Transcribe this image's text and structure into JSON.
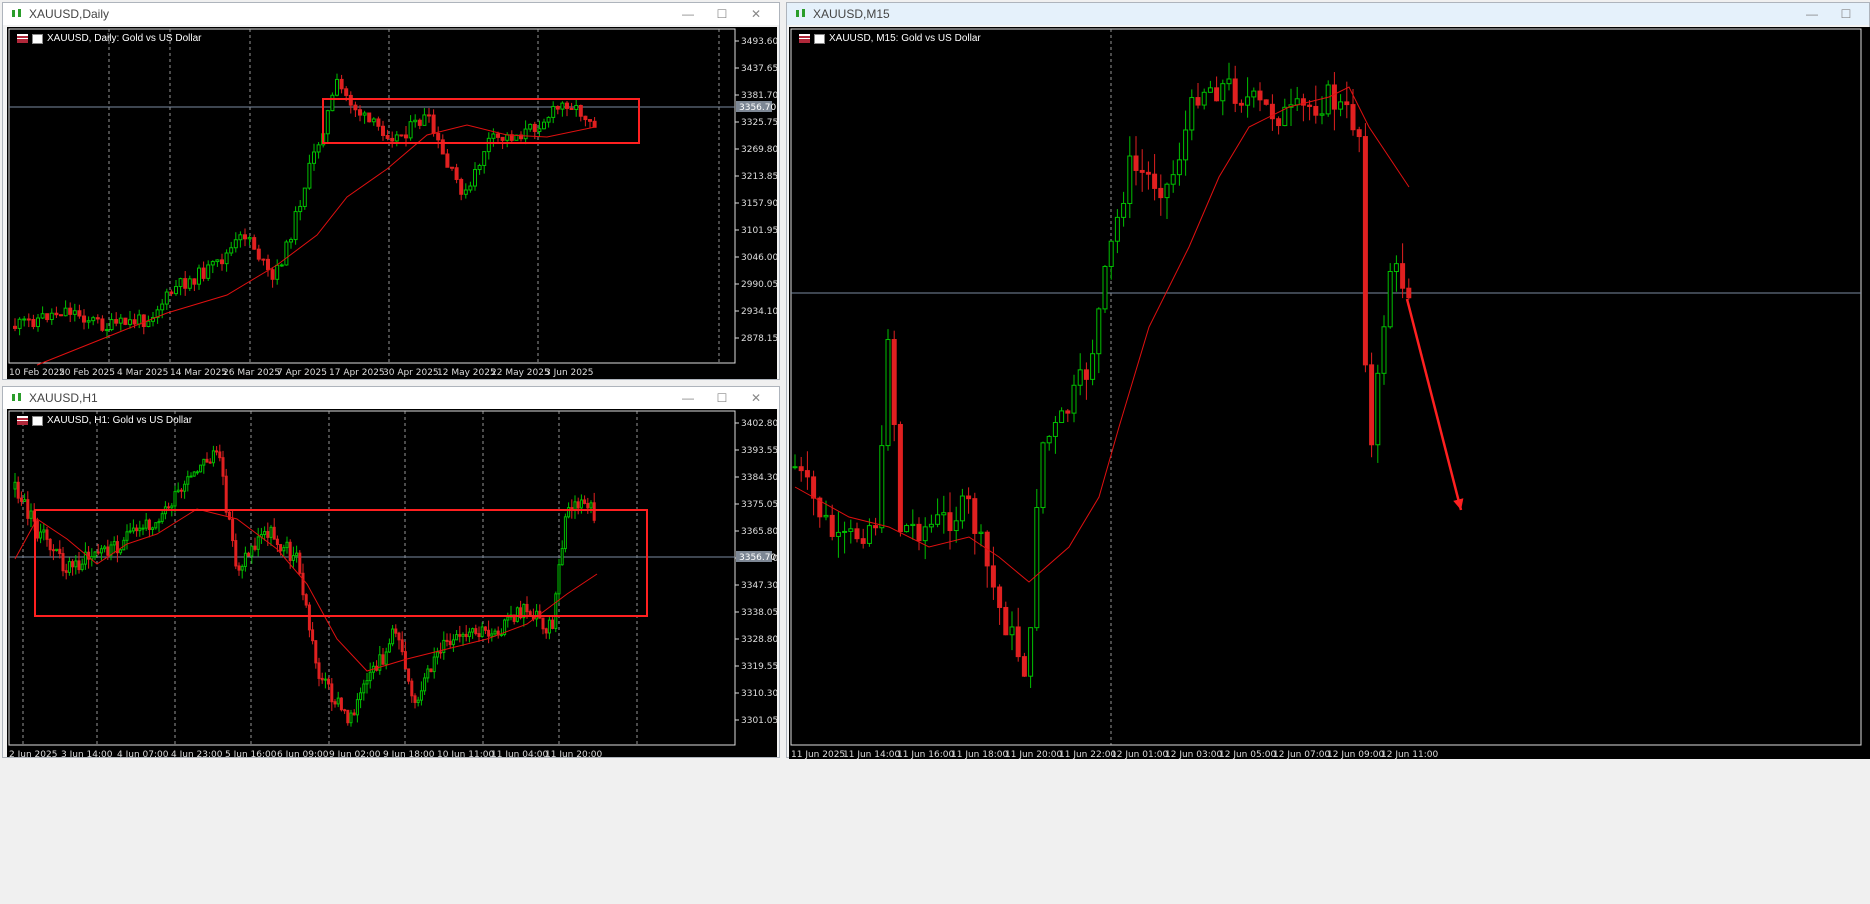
{
  "windows": {
    "daily": {
      "title": "XAUUSD,Daily",
      "label": "XAUUSD, Daily:  Gold vs US Dollar",
      "price_ticks": [
        "3493.60",
        "3437.65",
        "3381.70",
        "3325.75",
        "3269.80",
        "3213.85",
        "3157.90",
        "3101.95",
        "3046.00",
        "2990.05",
        "2934.10",
        "2878.15"
      ],
      "current_price": "3356.70",
      "time_ticks": [
        "10 Feb 2025",
        "20 Feb 2025",
        "4 Mar 2025",
        "14 Mar 2025",
        "26 Mar 2025",
        "7 Apr 2025",
        "17 Apr 2025",
        "30 Apr 2025",
        "12 May 2025",
        "22 May 2025",
        "3 Jun 2025"
      ]
    },
    "h1": {
      "title": "XAUUSD,H1",
      "label": "XAUUSD, H1:  Gold vs US Dollar",
      "price_ticks": [
        "3402.80",
        "3393.55",
        "3384.30",
        "3375.05",
        "3365.80",
        "3356.70",
        "3347.30",
        "3338.05",
        "3328.80",
        "3319.55",
        "3310.30",
        "3301.05"
      ],
      "current_price": "3356.70",
      "time_ticks": [
        "2 Jun 2025",
        "3 Jun 14:00",
        "4 Jun 07:00",
        "4 Jun 23:00",
        "5 Jun 16:00",
        "6 Jun 09:00",
        "9 Jun 02:00",
        "9 Jun 18:00",
        "10 Jun 11:00",
        "11 Jun 04:00",
        "11 Jun 20:00"
      ]
    },
    "m15": {
      "title": "XAUUSD,M15",
      "label": "XAUUSD, M15:  Gold vs US Dollar",
      "time_ticks": [
        "11 Jun 2025",
        "11 Jun 14:00",
        "11 Jun 16:00",
        "11 Jun 18:00",
        "11 Jun 20:00",
        "11 Jun 22:00",
        "12 Jun 01:00",
        "12 Jun 03:00",
        "12 Jun 05:00",
        "12 Jun 07:00",
        "12 Jun 09:00",
        "12 Jun 11:00"
      ]
    }
  },
  "buttons": {
    "minimize": "—",
    "maximize": "☐",
    "close": "✕"
  },
  "colors": {
    "bull": "#00c000",
    "bear": "#e02020",
    "ma": "#e01010",
    "box": "#ff2020",
    "grid": "#bbbbbb",
    "price_line": "#7a8aa0"
  }
}
